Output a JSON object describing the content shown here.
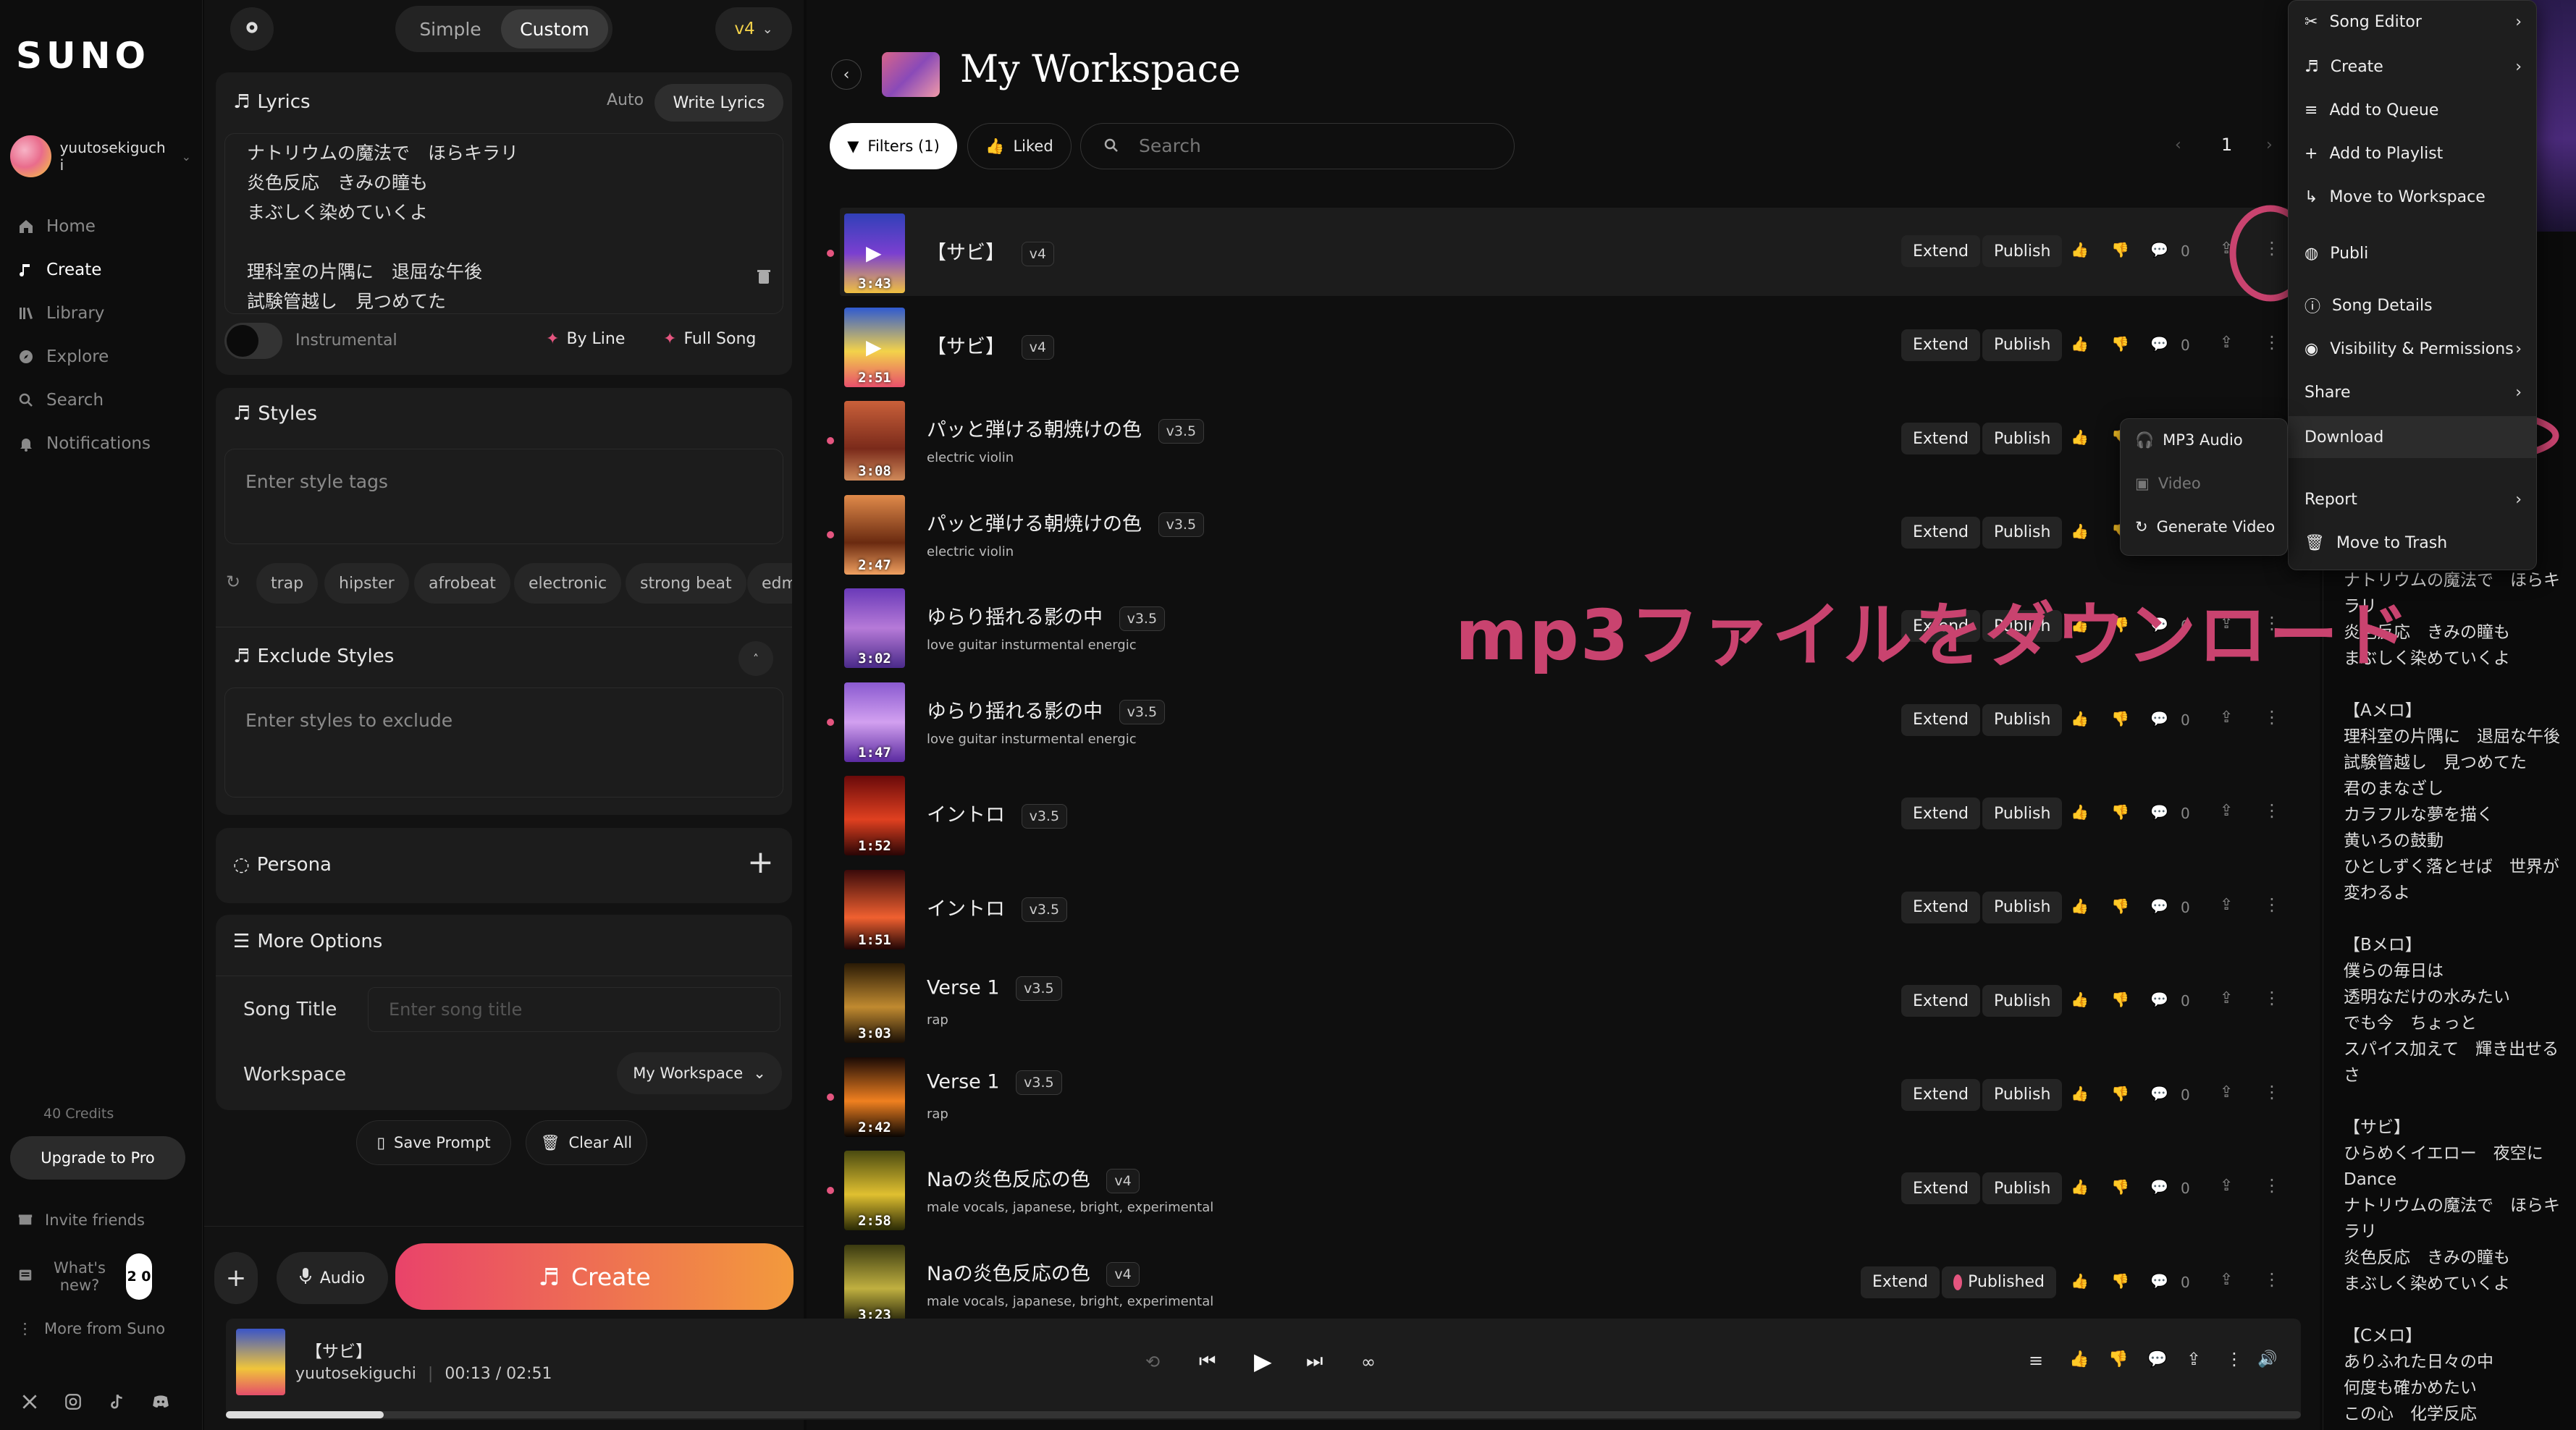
{
  "app": {
    "logo": "SUNO"
  },
  "sidebar": {
    "username": "yuutosekiguch i",
    "nav": [
      {
        "label": "Home",
        "icon": "home-icon"
      },
      {
        "label": "Create",
        "icon": "music-note-icon"
      },
      {
        "label": "Library",
        "icon": "library-icon"
      },
      {
        "label": "Explore",
        "icon": "compass-icon"
      },
      {
        "label": "Search",
        "icon": "search-icon"
      },
      {
        "label": "Notifications",
        "icon": "bell-icon"
      }
    ],
    "credits": "40 Credits",
    "upgrade": "Upgrade to Pro",
    "invite": "Invite friends",
    "whats_new": "What's new?",
    "whats_new_badge": "2 0",
    "more": "More from Suno"
  },
  "panel": {
    "mode_simple": "Simple",
    "mode_custom": "Custom",
    "model": "v4",
    "lyrics_label": "Lyrics",
    "lyrics_auto": "Auto",
    "lyrics_write": "Write Lyrics",
    "lyrics_text": "ナトリウムの魔法で　ほらキラリ\n炎色反応　きみの瞳も\nまぶしく染めていくよ\n\n理科室の片隅に　退屈な午後\n試験管越し　見つめてた",
    "instrumental": "Instrumental",
    "by_line": "By Line",
    "full_song": "Full Song",
    "styles_label": "Styles",
    "styles_placeholder": "Enter style tags",
    "style_tags": [
      "trap",
      "hipster",
      "afrobeat",
      "electronic",
      "strong beat",
      "edm"
    ],
    "exclude_label": "Exclude Styles",
    "exclude_placeholder": "Enter styles to exclude",
    "persona_label": "Persona",
    "more_options": "More Options",
    "song_title_label": "Song Title",
    "song_title_placeholder": "Enter song title",
    "workspace_label": "Workspace",
    "workspace_value": "My Workspace",
    "save_prompt": "Save Prompt",
    "clear_all": "Clear All",
    "audio": "Audio",
    "create": "Create"
  },
  "main": {
    "title": "My Workspace",
    "filters": "Filters (1)",
    "liked": "Liked",
    "search_placeholder": "Search",
    "page": "1",
    "songs": [
      {
        "title": "【サビ】",
        "version": "v4",
        "subtitle": "",
        "duration": "3:43",
        "dot": true,
        "selected": true,
        "extend": "Extend",
        "publish": "Publish",
        "comments": "0"
      },
      {
        "title": "【サビ】",
        "version": "v4",
        "subtitle": "",
        "duration": "2:51",
        "dot": false,
        "extend": "Extend",
        "publish": "Publish",
        "comments": "0"
      },
      {
        "title": "パッと弾ける朝焼けの色",
        "version": "v3.5",
        "subtitle": "electric violin",
        "duration": "3:08",
        "dot": true,
        "extend": "Extend",
        "publish": "Publish",
        "comments": "0"
      },
      {
        "title": "パッと弾ける朝焼けの色",
        "version": "v3.5",
        "subtitle": "electric violin",
        "duration": "2:47",
        "dot": true,
        "extend": "Extend",
        "publish": "Publish",
        "comments": "0"
      },
      {
        "title": "ゆらり揺れる影の中",
        "version": "v3.5",
        "subtitle": "love guitar insturmental energic",
        "duration": "3:02",
        "dot": false,
        "extend": "Extend",
        "publish": "Publish",
        "comments": "0"
      },
      {
        "title": "ゆらり揺れる影の中",
        "version": "v3.5",
        "subtitle": "love guitar insturmental energic",
        "duration": "1:47",
        "dot": true,
        "extend": "Extend",
        "publish": "Publish",
        "comments": "0"
      },
      {
        "title": "イントロ",
        "version": "v3.5",
        "subtitle": "",
        "duration": "1:52",
        "dot": false,
        "extend": "Extend",
        "publish": "Publish",
        "comments": "0"
      },
      {
        "title": "イントロ",
        "version": "v3.5",
        "subtitle": "",
        "duration": "1:51",
        "dot": false,
        "extend": "Extend",
        "publish": "Publish",
        "comments": "0"
      },
      {
        "title": "Verse 1",
        "version": "v3.5",
        "subtitle": "rap",
        "duration": "3:03",
        "dot": false,
        "extend": "Extend",
        "publish": "Publish",
        "comments": "0"
      },
      {
        "title": "Verse 1",
        "version": "v3.5",
        "subtitle": "rap",
        "duration": "2:42",
        "dot": true,
        "extend": "Extend",
        "publish": "Publish",
        "comments": "0"
      },
      {
        "title": "Naの炎色反応の色",
        "version": "v4",
        "subtitle": "male vocals, japanese, bright, experimental",
        "duration": "2:58",
        "dot": true,
        "extend": "Extend",
        "publish": "Publish",
        "comments": "0"
      },
      {
        "title": "Naの炎色反応の色",
        "version": "v4",
        "subtitle": "male vocals, japanese, bright, experimental",
        "duration": "3:23",
        "dot": false,
        "extend": "Extend",
        "publish": "Published",
        "comments": "0"
      }
    ]
  },
  "context_menu": {
    "items": [
      "Song Editor",
      "Create",
      "Add to Queue",
      "Add to Playlist",
      "Move to Workspace",
      "Publi",
      "Song Details",
      "Visibility & Permissions",
      "Share",
      "Download",
      "Report",
      "Move to Trash"
    ]
  },
  "download_submenu": {
    "items": [
      "MP3 Audio",
      "Video",
      "Generate Video"
    ]
  },
  "annotation": {
    "text": "mp3ファイルをダウンロード",
    "color": "#c9436f"
  },
  "right_lyrics": {
    "text": "ナトリウムの魔法で　ほらキラリ\n炎色反応　きみの瞳も\nまぶしく染めていくよ\n\n【Aメロ】\n理科室の片隅に　退屈な午後\n試験管越し　見つめてた\n君のまなざし\nカラフルな夢を描く\n黄いろの鼓動\nひとしずく落とせば　世界が変わるよ\n\n【Bメロ】\n僕らの毎日は\n透明なだけの水みたい\nでも今　ちょっと\nスパイス加えて　輝き出せるさ\n\n【サビ】\nひらめくイエロー　夜空にDance\nナトリウムの魔法で　ほらキラリ\n炎色反応　きみの瞳も\nまぶしく染めていくよ\n\n【Cメロ】\nありふれた日々の中\n何度も確かめたい\nこの心　化学反応"
  },
  "player": {
    "title": "【サビ】",
    "artist": "yuutosekiguchi",
    "time": "00:13 / 02:51",
    "progress": 0.076
  },
  "colors": {
    "accent": "#e4557f",
    "create_gradient_start": "#e9436a",
    "create_gradient_end": "#f39a3c"
  }
}
